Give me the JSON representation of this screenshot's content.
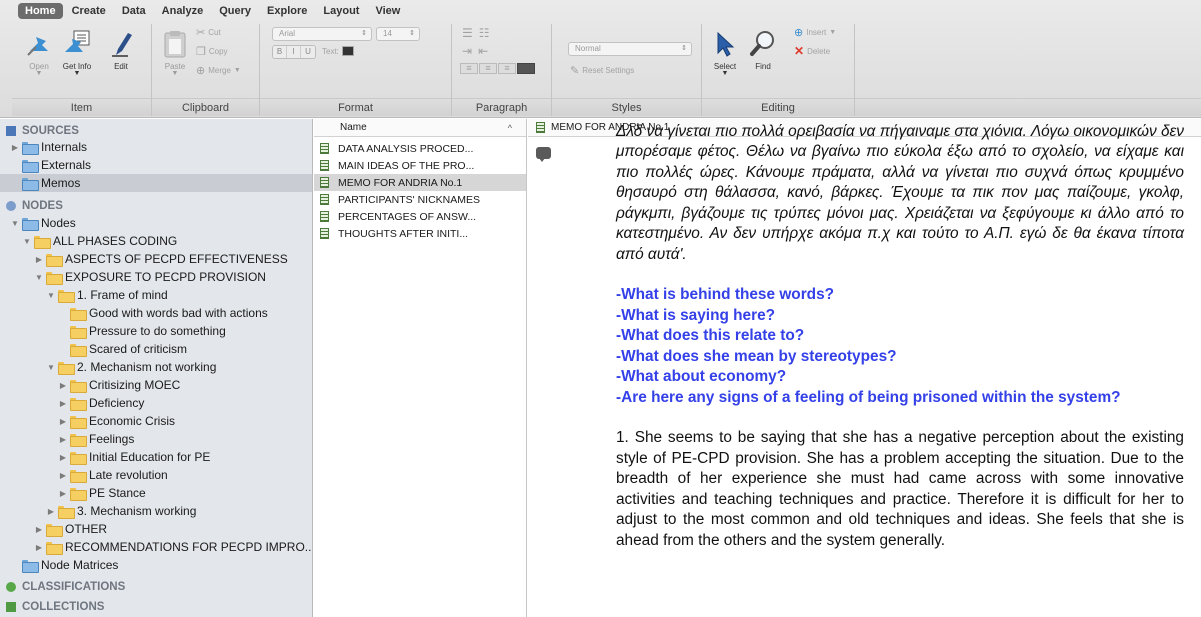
{
  "menu": {
    "tabs": [
      "Home",
      "Create",
      "Data",
      "Analyze",
      "Query",
      "Explore",
      "Layout",
      "View"
    ],
    "active": "Home"
  },
  "ribbon": {
    "item": {
      "label": "Item",
      "open": "Open",
      "get_info": "Get Info",
      "edit": "Edit"
    },
    "clipboard": {
      "label": "Clipboard",
      "paste": "Paste",
      "cut": "Cut",
      "copy": "Copy",
      "merge": "Merge"
    },
    "format": {
      "label": "Format",
      "font": "Arial",
      "size": "14",
      "b": "B",
      "i": "I",
      "u": "U",
      "text": "Text:"
    },
    "paragraph": {
      "label": "Paragraph"
    },
    "styles": {
      "label": "Styles",
      "style": "Normal",
      "reset": "Reset Settings"
    },
    "editing": {
      "label": "Editing",
      "select": "Select",
      "find": "Find",
      "insert": "Insert",
      "delete": "Delete"
    }
  },
  "nav": {
    "sources": "SOURCES",
    "internals": "Internals",
    "externals": "Externals",
    "memos": "Memos",
    "nodes_head": "NODES",
    "nodes": "Nodes",
    "all_phases": "ALL PHASES CODING",
    "aspects": "ASPECTS OF PECPD EFFECTIVENESS",
    "exposure": "EXPOSURE TO PECPD PROVISION",
    "frame": "1. Frame of mind",
    "good_words": "Good with words bad with actions",
    "pressure": "Pressure to do something",
    "scared": "Scared of criticism",
    "mechanism": "2. Mechanism not working",
    "critisizing": "Critisizing MOEC",
    "deficiency": "Deficiency",
    "economic": "Economic Crisis",
    "feelings": "Feelings",
    "initial_edu": "Initial Education for PE",
    "late_rev": "Late revolution",
    "pe_stance": "PE Stance",
    "mech_working": "3. Mechanism working",
    "other": "OTHER",
    "recommendations": "RECOMMENDATIONS FOR PECPD IMPRO...",
    "node_matrices": "Node Matrices",
    "classifications": "CLASSIFICATIONS",
    "collections": "COLLECTIONS"
  },
  "list": {
    "header": "Name",
    "items": [
      "DATA ANALYSIS PROCED...",
      "MAIN IDEAS OF THE PRO...",
      "MEMO FOR ANDRIA No.1",
      "PARTICIPANTS' NICKNAMES",
      "PERCENTAGES OF ANSW...",
      "THOUGHTS AFTER INITI..."
    ],
    "selected_index": 2
  },
  "doc": {
    "title": "MEMO FOR ANDRIA No.1",
    "quote": "Να φύγουν ακόμα και τα λίγα στερεότυπα που έχουμε. Να πάμε σε άλλα πράγματα. Δλδ να γίνεται πιο πολλά ορειβασία να πήγαιναμε στα χιόνια. Λόγω οικονομικών δεν μπορέσαμε φέτος. Θέλω να βγαίνω πιο εύκολα έξω από το σχολείο, να είχαμε και πιο πολλές ώρες. Κάνουμε πράματα, αλλά να γίνεται πιο συχνά όπως κρυμμένο θησαυρό στη θάλασσα, κανό, βάρκες. Έχουμε τα πικ πον μας παίζουμε, γκολφ, ράγκμπι, βγάζουμε τις τρύπες μόνοι μας. Χρειάζεται να ξεφύγουμε κι άλλο από το κατεστημένο. Αν δεν υπήρχε ακόμα π.χ και τούτο το Α.Π. εγώ δε θα έκανα τίποτα από αυτά'.",
    "questions": [
      "-What is behind these words?",
      "-What is saying here?",
      "-What does this relate to?",
      "-What does she mean by stereotypes?",
      "-What about economy?",
      "-Are here any signs of a feeling of being prisoned within the system?"
    ],
    "analysis": "1. She seems to be saying that she has a negative perception about the existing style of PE-CPD provision. She has a problem accepting the situation. Due to the breadth of her experience she must had came across with some innovative activities and teaching techniques and practice. Therefore it is difficult for her to adjust to the most common and old techniques and ideas. She feels that she is ahead from the others and the system generally."
  },
  "colors": {
    "question_blue": "#3440e8",
    "active_tab": "#6c6c6c",
    "nav_bg": "#e3e6ea"
  }
}
